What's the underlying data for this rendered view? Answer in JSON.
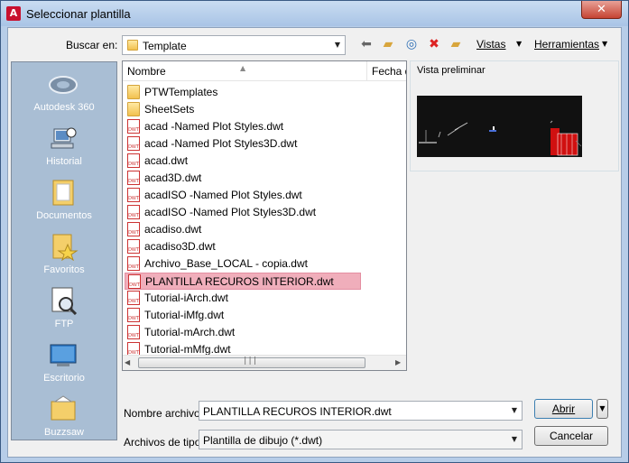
{
  "window": {
    "title": "Seleccionar plantilla",
    "app_icon_letter": "A",
    "close_glyph": "✕"
  },
  "toolbar": {
    "buscar_label": "Buscar en:",
    "location_value": "Template",
    "vistas_label": "Vistas",
    "herramientas_label": "Herramientas",
    "icons": [
      "back-icon",
      "up-folder-icon",
      "search-web-icon",
      "delete-icon",
      "new-folder-icon"
    ]
  },
  "places": [
    {
      "label": "Autodesk 360",
      "icon": "autodesk-360-icon"
    },
    {
      "label": "Historial",
      "icon": "history-icon"
    },
    {
      "label": "Documentos",
      "icon": "documents-icon"
    },
    {
      "label": "Favoritos",
      "icon": "favorites-icon"
    },
    {
      "label": "FTP",
      "icon": "ftp-icon"
    },
    {
      "label": "Escritorio",
      "icon": "desktop-icon"
    },
    {
      "label": "Buzzsaw",
      "icon": "buzzsaw-icon"
    }
  ],
  "filelist": {
    "columns": [
      "Nombre",
      "Fecha d"
    ],
    "items": [
      {
        "name": "PTWTemplates",
        "type": "folder"
      },
      {
        "name": "SheetSets",
        "type": "folder"
      },
      {
        "name": "acad -Named Plot Styles.dwt",
        "type": "dwt"
      },
      {
        "name": "acad -Named Plot Styles3D.dwt",
        "type": "dwt"
      },
      {
        "name": "acad.dwt",
        "type": "dwt"
      },
      {
        "name": "acad3D.dwt",
        "type": "dwt"
      },
      {
        "name": "acadISO -Named Plot Styles.dwt",
        "type": "dwt"
      },
      {
        "name": "acadISO -Named Plot Styles3D.dwt",
        "type": "dwt"
      },
      {
        "name": "acadiso.dwt",
        "type": "dwt"
      },
      {
        "name": "acadiso3D.dwt",
        "type": "dwt"
      },
      {
        "name": "Archivo_Base_LOCAL - copia.dwt",
        "type": "dwt"
      },
      {
        "name": "PLANTILLA RECUROS INTERIOR.dwt",
        "type": "dwt",
        "selected": true
      },
      {
        "name": "Tutorial-iArch.dwt",
        "type": "dwt"
      },
      {
        "name": "Tutorial-iMfg.dwt",
        "type": "dwt"
      },
      {
        "name": "Tutorial-mArch.dwt",
        "type": "dwt"
      },
      {
        "name": "Tutorial-mMfg.dwt",
        "type": "dwt"
      }
    ]
  },
  "preview": {
    "label": "Vista preliminar"
  },
  "form": {
    "filename_label": "Nombre archivo:",
    "filename_value": "PLANTILLA RECUROS INTERIOR.dwt",
    "filetype_label": "Archivos de tipo:",
    "filetype_value": "Plantilla de dibujo (*.dwt)",
    "open_label": "Abrir",
    "cancel_label": "Cancelar"
  },
  "colors": {
    "selection": "#f0aebb",
    "places_bg": "#a9bed4",
    "preview_bg": "#111111",
    "accent_red": "#c8102e"
  }
}
